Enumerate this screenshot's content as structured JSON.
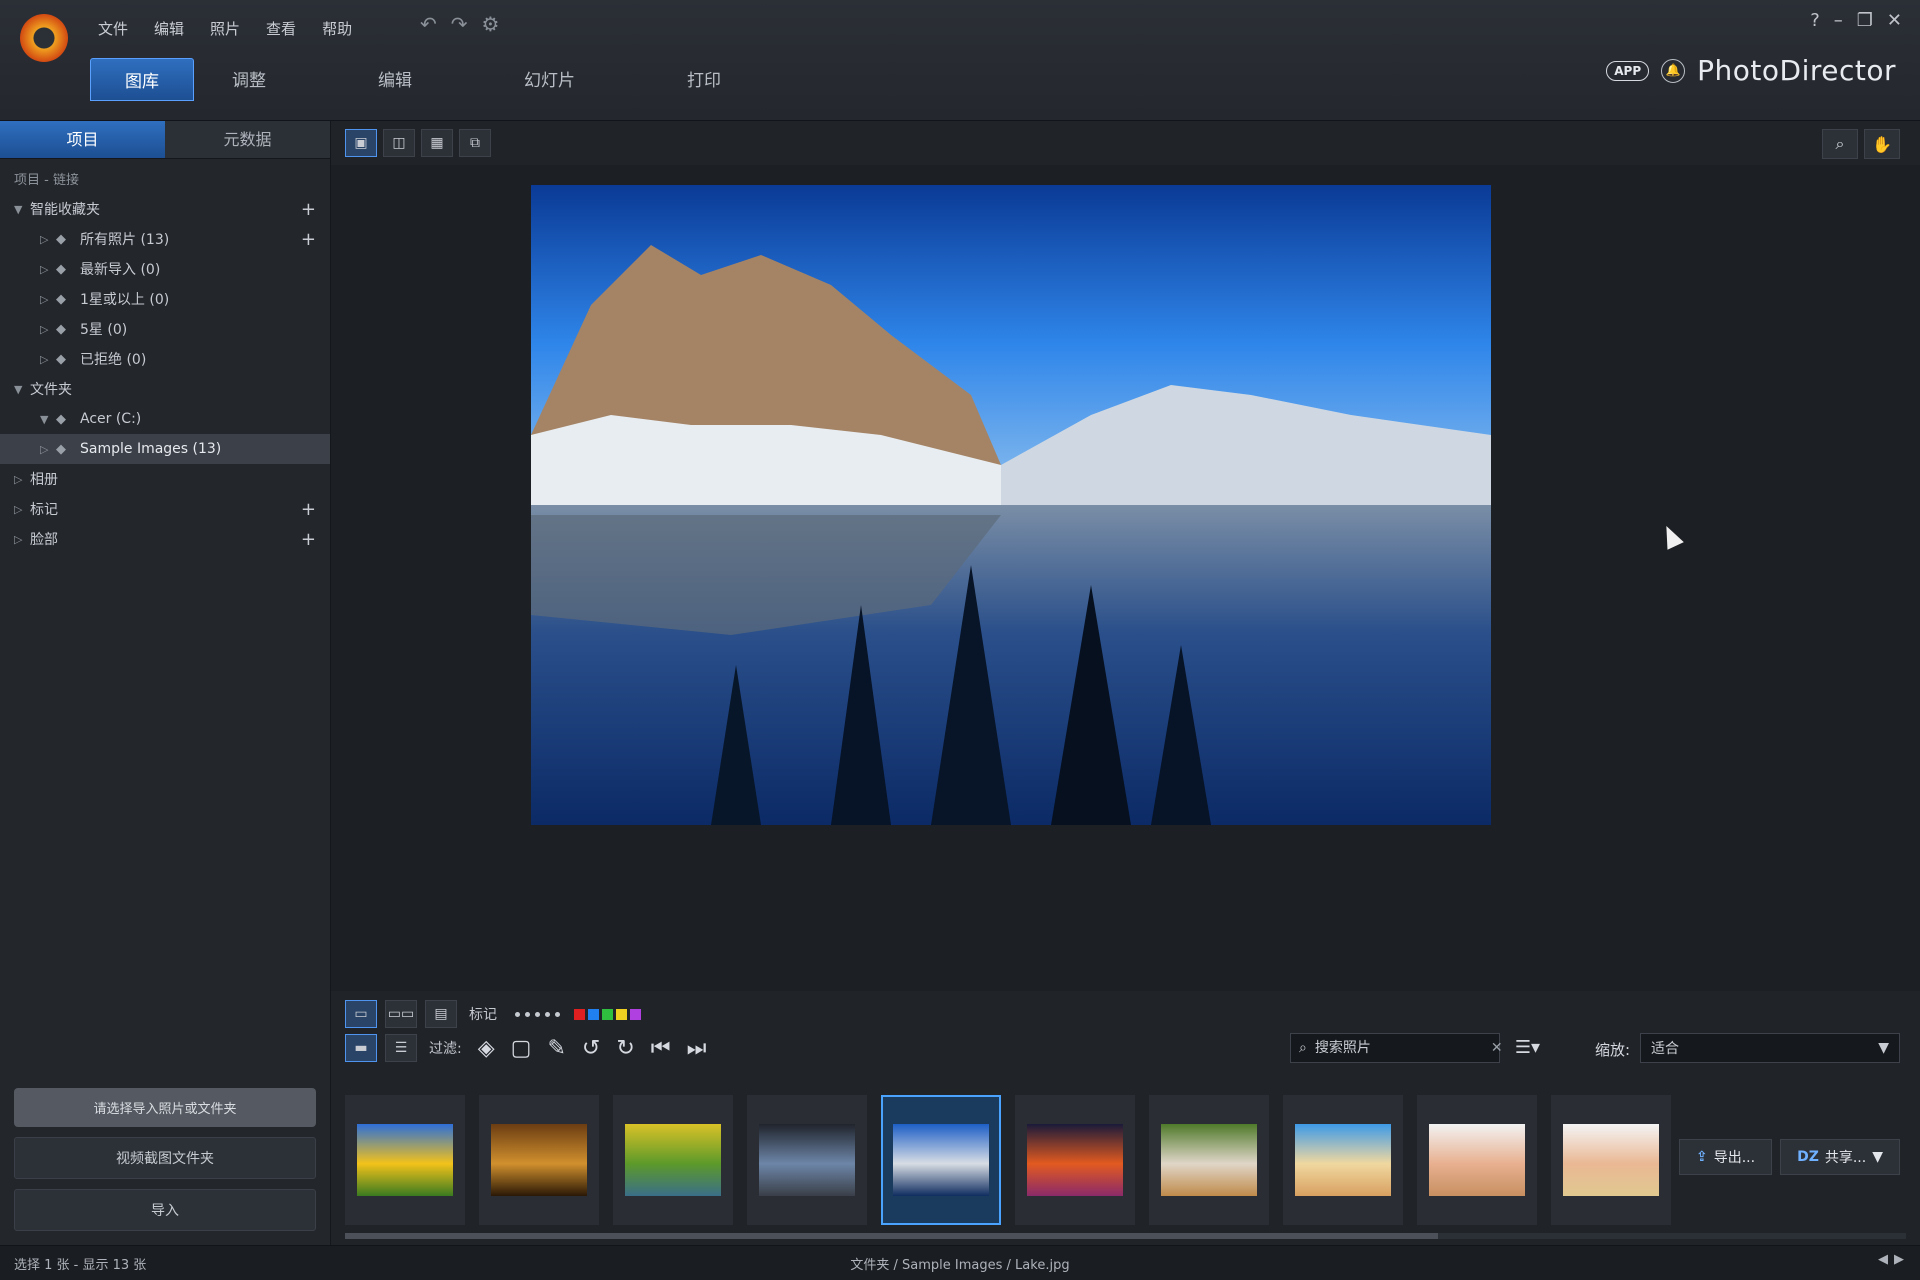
{
  "menu": [
    "文件",
    "编辑",
    "照片",
    "查看",
    "帮助"
  ],
  "main_tabs": [
    {
      "label": "图库",
      "active": true
    },
    {
      "label": "调整",
      "active": false
    },
    {
      "label": "编辑",
      "active": false
    },
    {
      "label": "幻灯片",
      "active": false
    },
    {
      "label": "打印",
      "active": false
    }
  ],
  "brand": {
    "app_badge": "APP",
    "name": "PhotoDirector"
  },
  "window_controls": {
    "help": "?",
    "minimize": "–",
    "restore": "❐",
    "close": "✕"
  },
  "sidebar": {
    "tabs": [
      {
        "label": "项目",
        "active": true
      },
      {
        "label": "元数据",
        "active": false
      }
    ],
    "project_label": "项目 - 链接",
    "tree": [
      {
        "label": "智能收藏夹",
        "level": 0,
        "arrow": "▼",
        "plus": "+"
      },
      {
        "label": "所有照片 (13)",
        "level": 1,
        "arrow": "▷",
        "plus": "+"
      },
      {
        "label": "最新导入 (0)",
        "level": 1,
        "arrow": "▷",
        "plus": ""
      },
      {
        "label": "1星或以上 (0)",
        "level": 1,
        "arrow": "▷",
        "plus": ""
      },
      {
        "label": "5星 (0)",
        "level": 1,
        "arrow": "▷",
        "plus": ""
      },
      {
        "label": "已拒绝 (0)",
        "level": 1,
        "arrow": "▷",
        "plus": ""
      },
      {
        "label": "文件夹",
        "level": 0,
        "arrow": "▼",
        "plus": ""
      },
      {
        "label": "Acer (C:)",
        "level": 1,
        "arrow": "▼",
        "plus": ""
      },
      {
        "label": "Sample Images (13)",
        "level": 1,
        "arrow": "▷",
        "plus": "",
        "selected": true
      },
      {
        "label": "相册",
        "level": 0,
        "arrow": "▷",
        "plus": ""
      },
      {
        "label": "标记",
        "level": 0,
        "arrow": "▷",
        "plus": "+"
      },
      {
        "label": "脸部",
        "level": 0,
        "arrow": "▷",
        "plus": "+"
      }
    ],
    "tip": "请选择导入照片或文件夹",
    "watch_folder_button": "视频截图文件夹",
    "import_button": "导入"
  },
  "toolbar": {
    "filter_label": "过滤:",
    "flag_label": "标记",
    "search_placeholder": "搜索照片",
    "zoom_label": "缩放:",
    "zoom_value": "适合",
    "export_button": "导出...",
    "share_button": "共享..."
  },
  "swatch_colors": [
    "#e02020",
    "#2080f0",
    "#30c040",
    "#f0d020",
    "#b040e0"
  ],
  "thumbnails": [
    {
      "name": "sunflower",
      "colors": [
        "#2d6fd8",
        "#f2c21a",
        "#3a7a20"
      ],
      "selected": false
    },
    {
      "name": "spiral",
      "colors": [
        "#6b3d12",
        "#d1902e",
        "#2a1806"
      ],
      "selected": false
    },
    {
      "name": "bicycle",
      "colors": [
        "#d9c227",
        "#5d9a2a",
        "#3a6e88"
      ],
      "selected": false
    },
    {
      "name": "lake-dark",
      "colors": [
        "#20242c",
        "#6d86a8",
        "#3a3f48"
      ],
      "selected": false
    },
    {
      "name": "lake",
      "colors": [
        "#1d5fc7",
        "#d8dde4",
        "#0f2d60"
      ],
      "selected": true
    },
    {
      "name": "sunset",
      "colors": [
        "#1a1a3a",
        "#e25a20",
        "#8a2a6a"
      ],
      "selected": false
    },
    {
      "name": "kitten",
      "colors": [
        "#4f7a2a",
        "#e0d6c8",
        "#c08a4a"
      ],
      "selected": false
    },
    {
      "name": "beach",
      "colors": [
        "#3d9ae8",
        "#f0d8a0",
        "#d8a060"
      ],
      "selected": false
    },
    {
      "name": "woman",
      "colors": [
        "#f2f2f2",
        "#e8b090",
        "#c89060"
      ],
      "selected": false
    },
    {
      "name": "girl",
      "colors": [
        "#f4f4f4",
        "#eab894",
        "#e0c890"
      ],
      "selected": false
    }
  ],
  "status": {
    "selection": "选择 1 张 - 显示 13 张",
    "path": "文件夹 / Sample Images / Lake.jpg"
  }
}
